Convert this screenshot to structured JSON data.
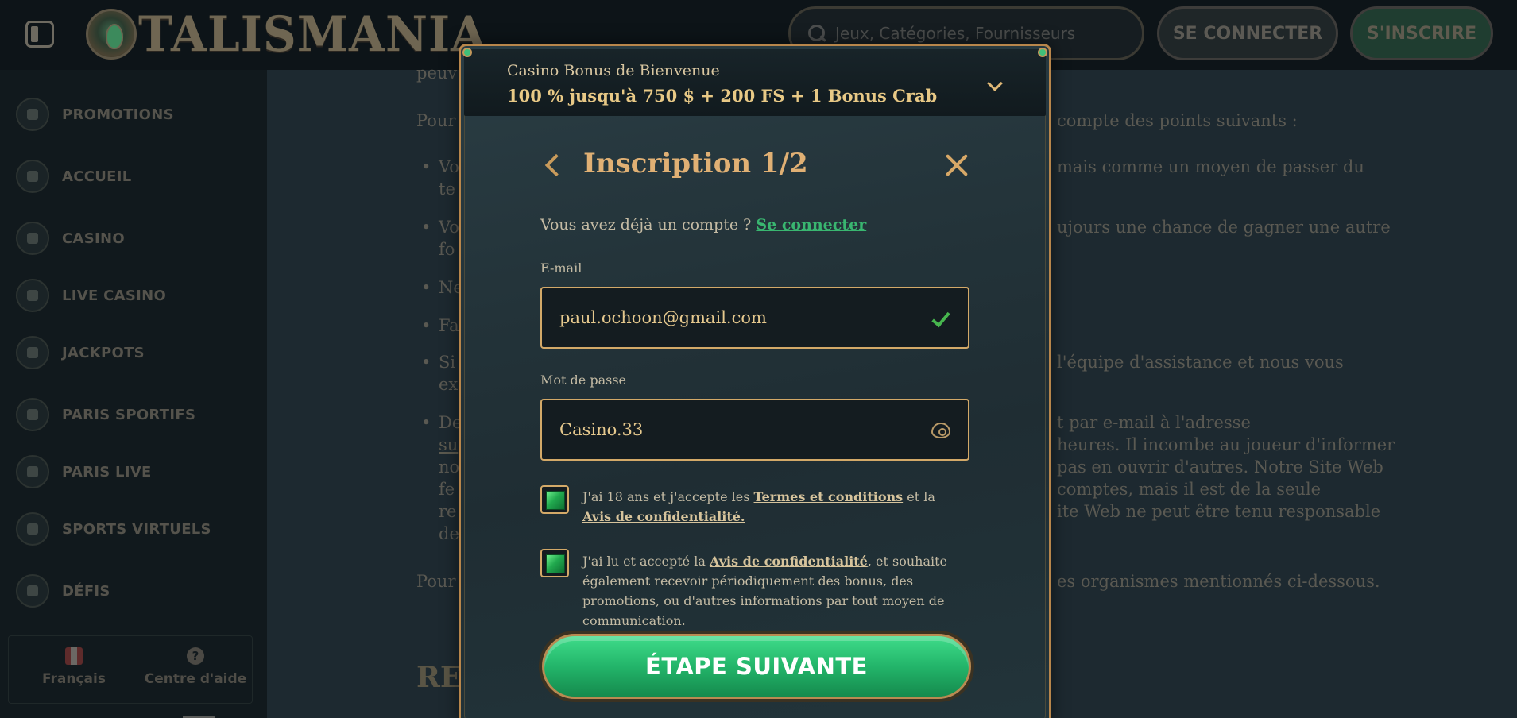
{
  "header": {
    "logo_text": "TALISMANIA",
    "search_placeholder": "Jeux, Catégories, Fournisseurs",
    "login_label": "SE CONNECTER",
    "register_label": "S'INSCRIRE"
  },
  "sidebar": {
    "items": [
      {
        "label": "PROMOTIONS",
        "icon": "gift-icon"
      },
      {
        "label": "ACCUEIL",
        "icon": "home-icon"
      },
      {
        "label": "CASINO",
        "icon": "casino-chip-icon"
      },
      {
        "label": "LIVE CASINO",
        "icon": "spade-icon"
      },
      {
        "label": "JACKPOTS",
        "icon": "clover-icon"
      },
      {
        "label": "PARIS SPORTIFS",
        "icon": "soccer-ball-icon"
      },
      {
        "label": "PARIS LIVE",
        "icon": "play-icon"
      },
      {
        "label": "SPORTS VIRTUELS",
        "icon": "virtual-sports-icon"
      },
      {
        "label": "DÉFIS",
        "icon": "medal-icon"
      }
    ],
    "footer": {
      "language_label": "Français",
      "help_label": "Centre d'aide"
    }
  },
  "background": {
    "lines": [
      "peuv",
      "Pour",
      "compte des points suivants :",
      "Vo",
      "mais comme un moyen de passer du",
      "te",
      "Vo",
      "ujours une chance de gagner une autre",
      "fo",
      "Ne",
      "Fa",
      "Si",
      "l'équipe d'assistance et nous vous",
      "ex",
      "De",
      "t par e-mail à l'adresse",
      "su",
      "heures. Il incombe au joueur d'informer",
      "no",
      "pas en ouvrir d'autres. Notre Site Web",
      "fe",
      "comptes, mais il est de la seule",
      "re",
      "ite Web ne peut être tenu responsable",
      "de",
      "Pour",
      "es organismes mentionnés ci-dessous.",
      "RE"
    ]
  },
  "modal": {
    "bonus_subtitle": "Casino Bonus de Bienvenue",
    "bonus_title": "100 % jusqu'à 750 $ + 200 FS + 1 Bonus Crab",
    "title": "Inscription 1/2",
    "have_account_text": "Vous avez déjà un compte ?",
    "signin_link": "Se connecter",
    "email_label": "E-mail",
    "email_value": "paul.ochoon@gmail.com",
    "password_label": "Mot de passe",
    "password_value": "Casino.33",
    "consent1_prefix": "J'ai 18 ans et j'accepte les",
    "consent1_terms_link": "Termes et conditions",
    "consent1_middle": "et la",
    "consent1_privacy_link": "Avis de confidentialité.",
    "consent2_prefix": "J'ai lu et accepté la",
    "consent2_privacy_link": "Avis de confidentialité",
    "consent2_suffix": ", et souhaite également recevoir périodiquement des bonus, des promotions, ou d'autres informations par tout moyen de communication.",
    "next_button": "ÉTAPE SUIVANTE"
  },
  "colors": {
    "accent_gold": "#d3a968",
    "accent_green": "#23b56a",
    "link_green": "#39b670"
  }
}
